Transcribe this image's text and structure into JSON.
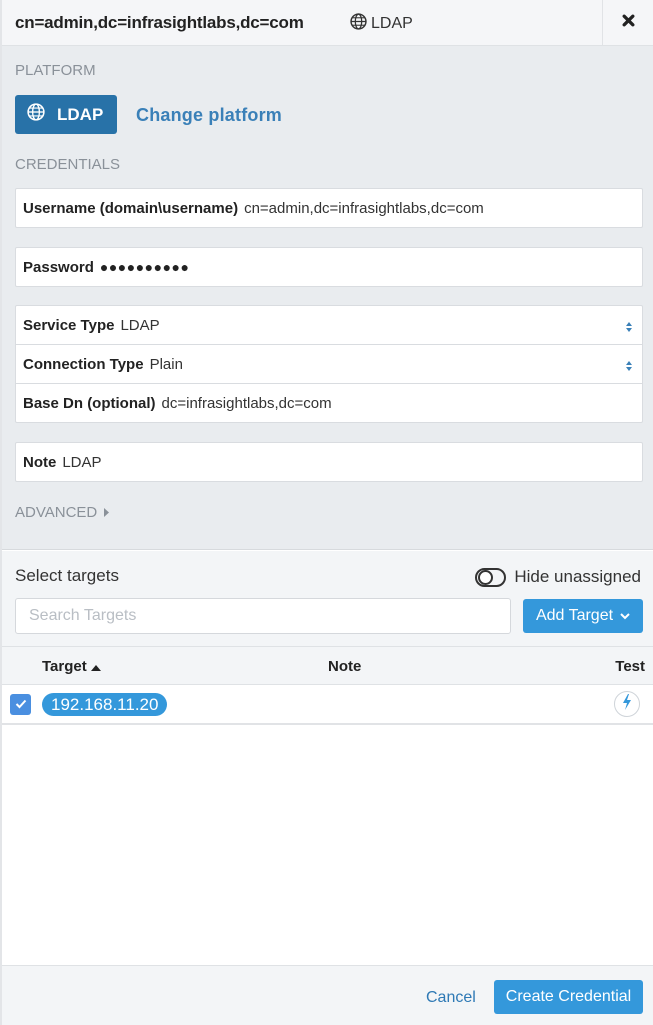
{
  "header": {
    "title": "cn=admin,dc=infrasightlabs,dc=com",
    "platform_icon": "globe-icon",
    "platform_label": "LDAP",
    "close_icon": "close-icon"
  },
  "platform": {
    "section_label": "PLATFORM",
    "button_icon": "globe-icon",
    "button_label": "LDAP",
    "change_label": "Change platform"
  },
  "credentials": {
    "section_label": "CREDENTIALS",
    "username": {
      "label": "Username (domain\\username)",
      "value": "cn=admin,dc=infrasightlabs,dc=com"
    },
    "password": {
      "label": "Password",
      "value": "●●●●●●●●●●"
    },
    "service_type": {
      "label": "Service Type",
      "value": "LDAP"
    },
    "connection_type": {
      "label": "Connection Type",
      "value": "Plain"
    },
    "base_dn": {
      "label": "Base Dn (optional)",
      "value": "dc=infrasightlabs,dc=com"
    },
    "note": {
      "label": "Note",
      "value": "LDAP"
    },
    "advanced_label": "ADVANCED"
  },
  "targets": {
    "title": "Select targets",
    "hide_unassigned_label": "Hide unassigned",
    "hide_unassigned_on": false,
    "search_placeholder": "Search Targets",
    "search_value": "",
    "add_target_label": "Add Target",
    "columns": [
      "Target",
      "Note",
      "Test"
    ],
    "sort_column": "Target",
    "sort_direction": "ascending",
    "rows": [
      {
        "checked": true,
        "target": "192.168.11.20",
        "note": ""
      }
    ]
  },
  "colors": {
    "primary": "#3498db",
    "platform_button": "#2872a8",
    "link": "#3a80b8",
    "checkbox": "#4a8fe0"
  },
  "footer": {
    "cancel_label": "Cancel",
    "create_label": "Create Credential"
  }
}
